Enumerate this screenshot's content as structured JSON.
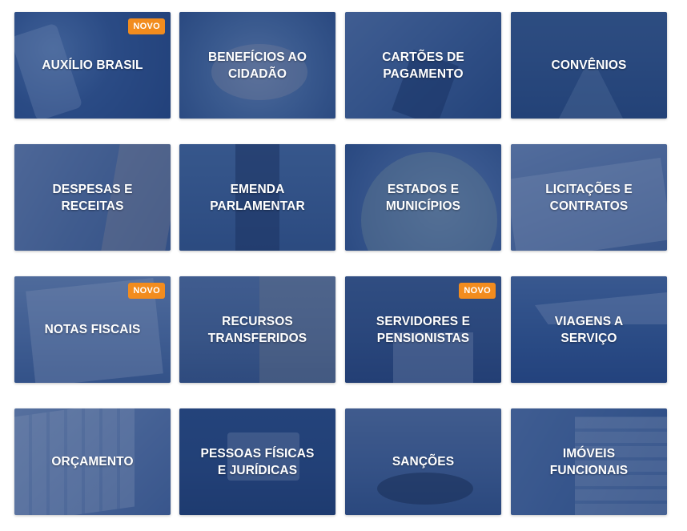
{
  "badge_label": "NOVO",
  "badge_color": "#f28c1e",
  "overlay_color": "#1c3a76",
  "cards": [
    {
      "label": "AUXÍLIO BRASIL",
      "badge": true
    },
    {
      "label": "BENEFÍCIOS AO CIDADÃO",
      "badge": false
    },
    {
      "label": "CARTÕES DE PAGAMENTO",
      "badge": false
    },
    {
      "label": "CONVÊNIOS",
      "badge": false
    },
    {
      "label": "DESPESAS E RECEITAS",
      "badge": false
    },
    {
      "label": "EMENDA PARLAMENTAR",
      "badge": false
    },
    {
      "label": "ESTADOS E MUNICÍPIOS",
      "badge": false
    },
    {
      "label": "LICITAÇÕES E CONTRATOS",
      "badge": false
    },
    {
      "label": "NOTAS FISCAIS",
      "badge": true
    },
    {
      "label": "RECURSOS TRANSFERIDOS",
      "badge": false
    },
    {
      "label": "SERVIDORES E PENSIONISTAS",
      "badge": true
    },
    {
      "label": "VIAGENS A SERVIÇO",
      "badge": false
    },
    {
      "label": "ORÇAMENTO",
      "badge": false
    },
    {
      "label": "PESSOAS FÍSICAS E JURÍDICAS",
      "badge": false
    },
    {
      "label": "SANÇÕES",
      "badge": false
    },
    {
      "label": "IMÓVEIS FUNCIONAIS",
      "badge": false
    }
  ]
}
